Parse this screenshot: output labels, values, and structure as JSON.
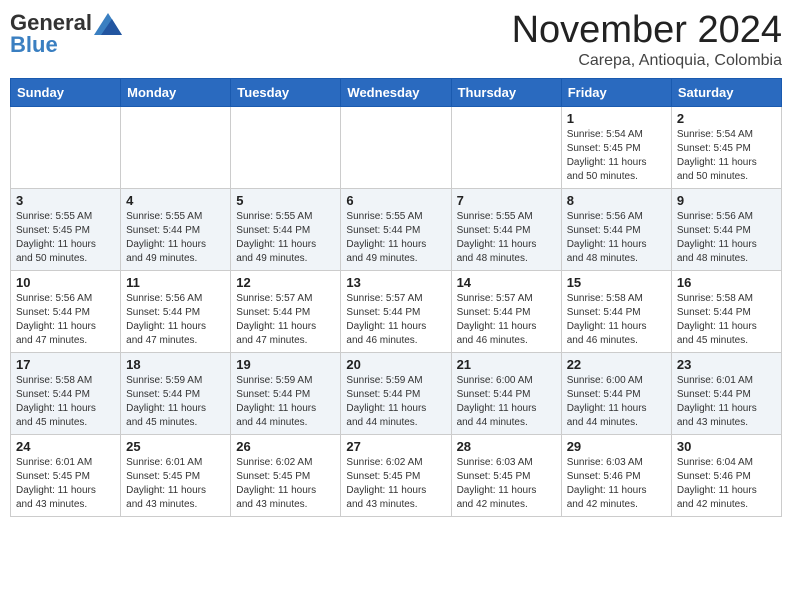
{
  "header": {
    "logo_general": "General",
    "logo_blue": "Blue",
    "month_title": "November 2024",
    "location": "Carepa, Antioquia, Colombia"
  },
  "calendar": {
    "headers": [
      "Sunday",
      "Monday",
      "Tuesday",
      "Wednesday",
      "Thursday",
      "Friday",
      "Saturday"
    ],
    "weeks": [
      [
        {
          "day": "",
          "detail": ""
        },
        {
          "day": "",
          "detail": ""
        },
        {
          "day": "",
          "detail": ""
        },
        {
          "day": "",
          "detail": ""
        },
        {
          "day": "",
          "detail": ""
        },
        {
          "day": "1",
          "detail": "Sunrise: 5:54 AM\nSunset: 5:45 PM\nDaylight: 11 hours\nand 50 minutes."
        },
        {
          "day": "2",
          "detail": "Sunrise: 5:54 AM\nSunset: 5:45 PM\nDaylight: 11 hours\nand 50 minutes."
        }
      ],
      [
        {
          "day": "3",
          "detail": "Sunrise: 5:55 AM\nSunset: 5:45 PM\nDaylight: 11 hours\nand 50 minutes."
        },
        {
          "day": "4",
          "detail": "Sunrise: 5:55 AM\nSunset: 5:44 PM\nDaylight: 11 hours\nand 49 minutes."
        },
        {
          "day": "5",
          "detail": "Sunrise: 5:55 AM\nSunset: 5:44 PM\nDaylight: 11 hours\nand 49 minutes."
        },
        {
          "day": "6",
          "detail": "Sunrise: 5:55 AM\nSunset: 5:44 PM\nDaylight: 11 hours\nand 49 minutes."
        },
        {
          "day": "7",
          "detail": "Sunrise: 5:55 AM\nSunset: 5:44 PM\nDaylight: 11 hours\nand 48 minutes."
        },
        {
          "day": "8",
          "detail": "Sunrise: 5:56 AM\nSunset: 5:44 PM\nDaylight: 11 hours\nand 48 minutes."
        },
        {
          "day": "9",
          "detail": "Sunrise: 5:56 AM\nSunset: 5:44 PM\nDaylight: 11 hours\nand 48 minutes."
        }
      ],
      [
        {
          "day": "10",
          "detail": "Sunrise: 5:56 AM\nSunset: 5:44 PM\nDaylight: 11 hours\nand 47 minutes."
        },
        {
          "day": "11",
          "detail": "Sunrise: 5:56 AM\nSunset: 5:44 PM\nDaylight: 11 hours\nand 47 minutes."
        },
        {
          "day": "12",
          "detail": "Sunrise: 5:57 AM\nSunset: 5:44 PM\nDaylight: 11 hours\nand 47 minutes."
        },
        {
          "day": "13",
          "detail": "Sunrise: 5:57 AM\nSunset: 5:44 PM\nDaylight: 11 hours\nand 46 minutes."
        },
        {
          "day": "14",
          "detail": "Sunrise: 5:57 AM\nSunset: 5:44 PM\nDaylight: 11 hours\nand 46 minutes."
        },
        {
          "day": "15",
          "detail": "Sunrise: 5:58 AM\nSunset: 5:44 PM\nDaylight: 11 hours\nand 46 minutes."
        },
        {
          "day": "16",
          "detail": "Sunrise: 5:58 AM\nSunset: 5:44 PM\nDaylight: 11 hours\nand 45 minutes."
        }
      ],
      [
        {
          "day": "17",
          "detail": "Sunrise: 5:58 AM\nSunset: 5:44 PM\nDaylight: 11 hours\nand 45 minutes."
        },
        {
          "day": "18",
          "detail": "Sunrise: 5:59 AM\nSunset: 5:44 PM\nDaylight: 11 hours\nand 45 minutes."
        },
        {
          "day": "19",
          "detail": "Sunrise: 5:59 AM\nSunset: 5:44 PM\nDaylight: 11 hours\nand 44 minutes."
        },
        {
          "day": "20",
          "detail": "Sunrise: 5:59 AM\nSunset: 5:44 PM\nDaylight: 11 hours\nand 44 minutes."
        },
        {
          "day": "21",
          "detail": "Sunrise: 6:00 AM\nSunset: 5:44 PM\nDaylight: 11 hours\nand 44 minutes."
        },
        {
          "day": "22",
          "detail": "Sunrise: 6:00 AM\nSunset: 5:44 PM\nDaylight: 11 hours\nand 44 minutes."
        },
        {
          "day": "23",
          "detail": "Sunrise: 6:01 AM\nSunset: 5:44 PM\nDaylight: 11 hours\nand 43 minutes."
        }
      ],
      [
        {
          "day": "24",
          "detail": "Sunrise: 6:01 AM\nSunset: 5:45 PM\nDaylight: 11 hours\nand 43 minutes."
        },
        {
          "day": "25",
          "detail": "Sunrise: 6:01 AM\nSunset: 5:45 PM\nDaylight: 11 hours\nand 43 minutes."
        },
        {
          "day": "26",
          "detail": "Sunrise: 6:02 AM\nSunset: 5:45 PM\nDaylight: 11 hours\nand 43 minutes."
        },
        {
          "day": "27",
          "detail": "Sunrise: 6:02 AM\nSunset: 5:45 PM\nDaylight: 11 hours\nand 43 minutes."
        },
        {
          "day": "28",
          "detail": "Sunrise: 6:03 AM\nSunset: 5:45 PM\nDaylight: 11 hours\nand 42 minutes."
        },
        {
          "day": "29",
          "detail": "Sunrise: 6:03 AM\nSunset: 5:46 PM\nDaylight: 11 hours\nand 42 minutes."
        },
        {
          "day": "30",
          "detail": "Sunrise: 6:04 AM\nSunset: 5:46 PM\nDaylight: 11 hours\nand 42 minutes."
        }
      ]
    ]
  }
}
